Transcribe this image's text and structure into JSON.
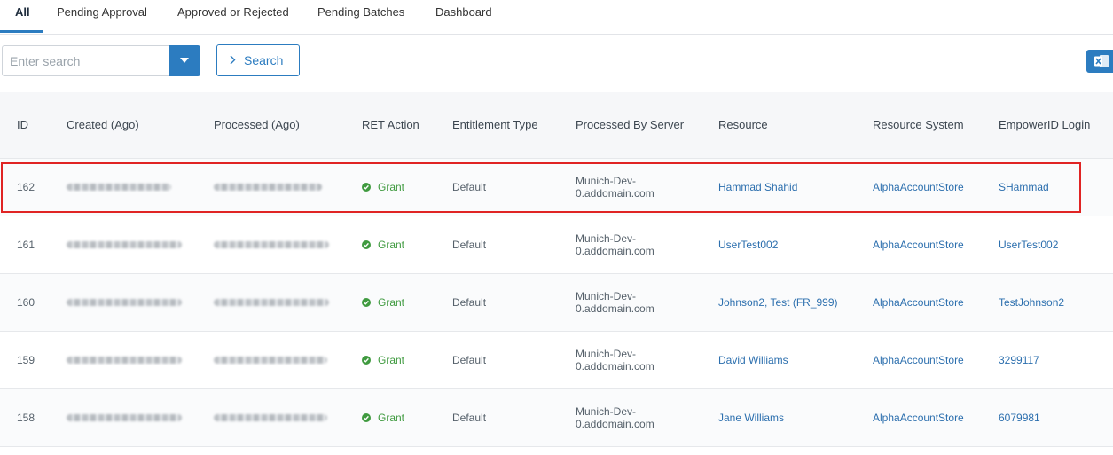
{
  "tabs": [
    {
      "label": "All",
      "active": true
    },
    {
      "label": "Pending Approval"
    },
    {
      "label": "Approved or Rejected"
    },
    {
      "label": "Pending Batches"
    },
    {
      "label": "Dashboard"
    }
  ],
  "search": {
    "placeholder": "Enter search",
    "button_label": "Search"
  },
  "icons": {
    "dropdown": "chevron-down-icon",
    "search_chevron": "chevron-right-icon",
    "export": "excel-icon",
    "grant": "check-circle-icon"
  },
  "colors": {
    "accent": "#2c7cc0",
    "grant": "#3f9a3f",
    "link": "#2c6fae",
    "highlight": "#e02424"
  },
  "table": {
    "headers": [
      "ID",
      "Created (Ago)",
      "Processed (Ago)",
      "RET Action",
      "Entitlement Type",
      "Processed By Server",
      "Resource",
      "Resource System",
      "EmpowerID Login"
    ],
    "rows": [
      {
        "id": "162",
        "ret_action": "Grant",
        "entitlement_type": "Default",
        "server_line1": "Munich-Dev-",
        "server_line2": "0.addomain.com",
        "resource": "Hammad Shahid",
        "resource_system": "AlphaAccountStore",
        "login": "SHammad",
        "highlighted": true
      },
      {
        "id": "161",
        "ret_action": "Grant",
        "entitlement_type": "Default",
        "server_line1": "Munich-Dev-",
        "server_line2": "0.addomain.com",
        "resource": "UserTest002",
        "resource_system": "AlphaAccountStore",
        "login": "UserTest002"
      },
      {
        "id": "160",
        "ret_action": "Grant",
        "entitlement_type": "Default",
        "server_line1": "Munich-Dev-",
        "server_line2": "0.addomain.com",
        "resource": "Johnson2, Test (FR_999)",
        "resource_system": "AlphaAccountStore",
        "login": "TestJohnson2"
      },
      {
        "id": "159",
        "ret_action": "Grant",
        "entitlement_type": "Default",
        "server_line1": "Munich-Dev-",
        "server_line2": "0.addomain.com",
        "resource": "David Williams",
        "resource_system": "AlphaAccountStore",
        "login": "3299117"
      },
      {
        "id": "158",
        "ret_action": "Grant",
        "entitlement_type": "Default",
        "server_line1": "Munich-Dev-",
        "server_line2": "0.addomain.com",
        "resource": "Jane Williams",
        "resource_system": "AlphaAccountStore",
        "login": "6079981"
      }
    ]
  }
}
